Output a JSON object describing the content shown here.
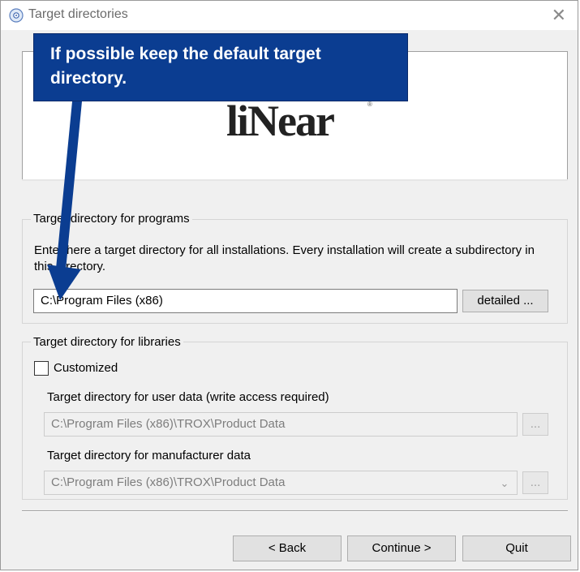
{
  "window": {
    "title": "Target directories",
    "close_glyph": "✕"
  },
  "banner": {
    "logo_text": "liNear",
    "logo_mark": "®"
  },
  "callout": {
    "text": "If possible keep the default target directory.",
    "color": "#0b3d91"
  },
  "programs": {
    "group_title": "Target directory for programs",
    "description": "Enter here a target directory for all installations. Every installation will create a subdirectory in this directory.",
    "path_value": "C:\\Program Files (x86)",
    "detailed_label": "detailed ..."
  },
  "libraries": {
    "group_title": "Target directory for libraries",
    "customized_label": "Customized",
    "customized_checked": false,
    "user_data_label": "Target directory for user data (write access required)",
    "user_data_value": "C:\\Program Files (x86)\\TROX\\Product Data",
    "manufacturer_label": "Target directory for manufacturer data",
    "manufacturer_value": "C:\\Program Files (x86)\\TROX\\Product Data",
    "browse_label": "..."
  },
  "buttons": {
    "back": "< Back",
    "continue": "Continue >",
    "quit": "Quit"
  }
}
